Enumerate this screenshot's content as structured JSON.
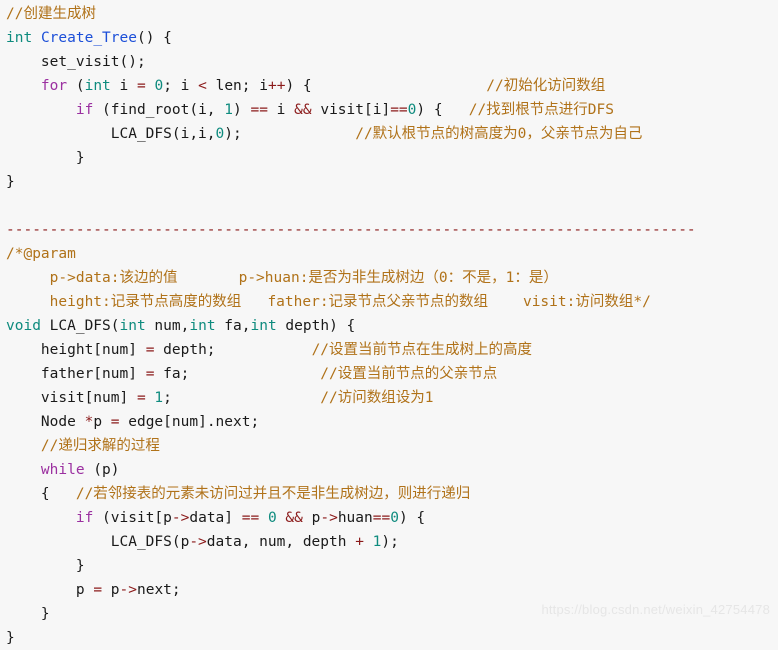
{
  "editor": {
    "background_color": "#f7f7f7",
    "language": "cpp",
    "colors": {
      "plain": "#1a1a1a",
      "keyword": "#9b30a0",
      "type": "#0e8b7e",
      "function": "#1c4fd8",
      "comment": "#b07219",
      "number": "#0e8b7e",
      "operator": "#8b1a1a"
    }
  },
  "watermark": {
    "text": "https://blog.csdn.net/weixin_42754478"
  },
  "lines": [
    {
      "id": "l1",
      "tokens": [
        {
          "t": "comment",
          "v": "//创建生成树"
        }
      ]
    },
    {
      "id": "l2",
      "tokens": [
        {
          "t": "type",
          "v": "int"
        },
        {
          "t": "plain",
          "v": " "
        },
        {
          "t": "func",
          "v": "Create_Tree"
        },
        {
          "t": "plain",
          "v": "() {"
        }
      ]
    },
    {
      "id": "l3",
      "tokens": [
        {
          "t": "plain",
          "v": "    set_visit();"
        }
      ]
    },
    {
      "id": "l4",
      "tokens": [
        {
          "t": "plain",
          "v": "    "
        },
        {
          "t": "keyword",
          "v": "for"
        },
        {
          "t": "plain",
          "v": " ("
        },
        {
          "t": "type",
          "v": "int"
        },
        {
          "t": "plain",
          "v": " i "
        },
        {
          "t": "op",
          "v": "="
        },
        {
          "t": "plain",
          "v": " "
        },
        {
          "t": "number",
          "v": "0"
        },
        {
          "t": "plain",
          "v": "; i "
        },
        {
          "t": "op",
          "v": "<"
        },
        {
          "t": "plain",
          "v": " len; i"
        },
        {
          "t": "op",
          "v": "++"
        },
        {
          "t": "plain",
          "v": ") {"
        },
        {
          "t": "pad",
          "v": "                    "
        },
        {
          "t": "comment",
          "v": "//初始化访问数组"
        }
      ]
    },
    {
      "id": "l5",
      "tokens": [
        {
          "t": "plain",
          "v": "        "
        },
        {
          "t": "keyword",
          "v": "if"
        },
        {
          "t": "plain",
          "v": " (find_root(i, "
        },
        {
          "t": "number",
          "v": "1"
        },
        {
          "t": "plain",
          "v": ") "
        },
        {
          "t": "op",
          "v": "=="
        },
        {
          "t": "plain",
          "v": " i "
        },
        {
          "t": "op",
          "v": "&&"
        },
        {
          "t": "plain",
          "v": " visit[i]"
        },
        {
          "t": "op",
          "v": "=="
        },
        {
          "t": "number",
          "v": "0"
        },
        {
          "t": "plain",
          "v": ") {   "
        },
        {
          "t": "comment",
          "v": "//找到根节点进行DFS"
        }
      ]
    },
    {
      "id": "l6",
      "tokens": [
        {
          "t": "plain",
          "v": "            LCA_DFS(i,i,"
        },
        {
          "t": "number",
          "v": "0"
        },
        {
          "t": "plain",
          "v": ");"
        },
        {
          "t": "pad",
          "v": "             "
        },
        {
          "t": "comment",
          "v": "//默认根节点的树高度为0，父亲节点为自己"
        }
      ]
    },
    {
      "id": "l7",
      "tokens": [
        {
          "t": "plain",
          "v": "        }"
        }
      ]
    },
    {
      "id": "l8",
      "tokens": [
        {
          "t": "plain",
          "v": "}"
        }
      ]
    },
    {
      "id": "l9",
      "tokens": [
        {
          "t": "plain",
          "v": ""
        }
      ]
    },
    {
      "id": "l10",
      "tokens": [
        {
          "t": "op",
          "v": "-------------------------------------------------------------------------------"
        }
      ]
    },
    {
      "id": "l11",
      "tokens": [
        {
          "t": "comment",
          "v": "/*@param"
        }
      ]
    },
    {
      "id": "l12",
      "tokens": [
        {
          "t": "comment",
          "v": "     p->data:该边的值       p->huan:是否为非生成树边（0：不是，1：是）"
        }
      ]
    },
    {
      "id": "l13",
      "tokens": [
        {
          "t": "comment",
          "v": "     height:记录节点高度的数组   father:记录节点父亲节点的数组    visit:访问数组*/"
        }
      ]
    },
    {
      "id": "l14",
      "tokens": [
        {
          "t": "type",
          "v": "void"
        },
        {
          "t": "plain",
          "v": " LCA_DFS("
        },
        {
          "t": "type",
          "v": "int"
        },
        {
          "t": "plain",
          "v": " num,"
        },
        {
          "t": "type",
          "v": "int"
        },
        {
          "t": "plain",
          "v": " fa,"
        },
        {
          "t": "type",
          "v": "int"
        },
        {
          "t": "plain",
          "v": " depth) {"
        }
      ]
    },
    {
      "id": "l15",
      "tokens": [
        {
          "t": "plain",
          "v": "    height[num] "
        },
        {
          "t": "op",
          "v": "="
        },
        {
          "t": "plain",
          "v": " depth;"
        },
        {
          "t": "pad",
          "v": "           "
        },
        {
          "t": "comment",
          "v": "//设置当前节点在生成树上的高度"
        }
      ]
    },
    {
      "id": "l16",
      "tokens": [
        {
          "t": "plain",
          "v": "    father[num] "
        },
        {
          "t": "op",
          "v": "="
        },
        {
          "t": "plain",
          "v": " fa;"
        },
        {
          "t": "pad",
          "v": "               "
        },
        {
          "t": "comment",
          "v": "//设置当前节点的父亲节点"
        }
      ]
    },
    {
      "id": "l17",
      "tokens": [
        {
          "t": "plain",
          "v": "    visit[num] "
        },
        {
          "t": "op",
          "v": "="
        },
        {
          "t": "plain",
          "v": " "
        },
        {
          "t": "number",
          "v": "1"
        },
        {
          "t": "plain",
          "v": ";"
        },
        {
          "t": "pad",
          "v": "                 "
        },
        {
          "t": "comment",
          "v": "//访问数组设为1"
        }
      ]
    },
    {
      "id": "l18",
      "tokens": [
        {
          "t": "plain",
          "v": "    Node "
        },
        {
          "t": "op",
          "v": "*"
        },
        {
          "t": "plain",
          "v": "p "
        },
        {
          "t": "op",
          "v": "="
        },
        {
          "t": "plain",
          "v": " edge[num].next;"
        }
      ]
    },
    {
      "id": "l19",
      "tokens": [
        {
          "t": "plain",
          "v": "    "
        },
        {
          "t": "comment",
          "v": "//递归求解的过程"
        }
      ]
    },
    {
      "id": "l20",
      "tokens": [
        {
          "t": "plain",
          "v": "    "
        },
        {
          "t": "keyword",
          "v": "while"
        },
        {
          "t": "plain",
          "v": " (p)"
        }
      ]
    },
    {
      "id": "l21",
      "tokens": [
        {
          "t": "plain",
          "v": "    {   "
        },
        {
          "t": "comment",
          "v": "//若邻接表的元素未访问过并且不是非生成树边，则进行递归"
        }
      ]
    },
    {
      "id": "l22",
      "tokens": [
        {
          "t": "plain",
          "v": "        "
        },
        {
          "t": "keyword",
          "v": "if"
        },
        {
          "t": "plain",
          "v": " (visit[p"
        },
        {
          "t": "op",
          "v": "->"
        },
        {
          "t": "plain",
          "v": "data] "
        },
        {
          "t": "op",
          "v": "=="
        },
        {
          "t": "plain",
          "v": " "
        },
        {
          "t": "number",
          "v": "0"
        },
        {
          "t": "plain",
          "v": " "
        },
        {
          "t": "op",
          "v": "&&"
        },
        {
          "t": "plain",
          "v": " p"
        },
        {
          "t": "op",
          "v": "->"
        },
        {
          "t": "plain",
          "v": "huan"
        },
        {
          "t": "op",
          "v": "=="
        },
        {
          "t": "number",
          "v": "0"
        },
        {
          "t": "plain",
          "v": ") {"
        }
      ]
    },
    {
      "id": "l23",
      "tokens": [
        {
          "t": "plain",
          "v": "            LCA_DFS(p"
        },
        {
          "t": "op",
          "v": "->"
        },
        {
          "t": "plain",
          "v": "data, num, depth "
        },
        {
          "t": "op",
          "v": "+"
        },
        {
          "t": "plain",
          "v": " "
        },
        {
          "t": "number",
          "v": "1"
        },
        {
          "t": "plain",
          "v": ");"
        }
      ]
    },
    {
      "id": "l24",
      "tokens": [
        {
          "t": "plain",
          "v": "        }"
        }
      ]
    },
    {
      "id": "l25",
      "tokens": [
        {
          "t": "plain",
          "v": "        p "
        },
        {
          "t": "op",
          "v": "="
        },
        {
          "t": "plain",
          "v": " p"
        },
        {
          "t": "op",
          "v": "->"
        },
        {
          "t": "plain",
          "v": "next;"
        }
      ]
    },
    {
      "id": "l26",
      "tokens": [
        {
          "t": "plain",
          "v": "    }"
        }
      ]
    },
    {
      "id": "l27",
      "tokens": [
        {
          "t": "plain",
          "v": "}"
        }
      ]
    }
  ]
}
